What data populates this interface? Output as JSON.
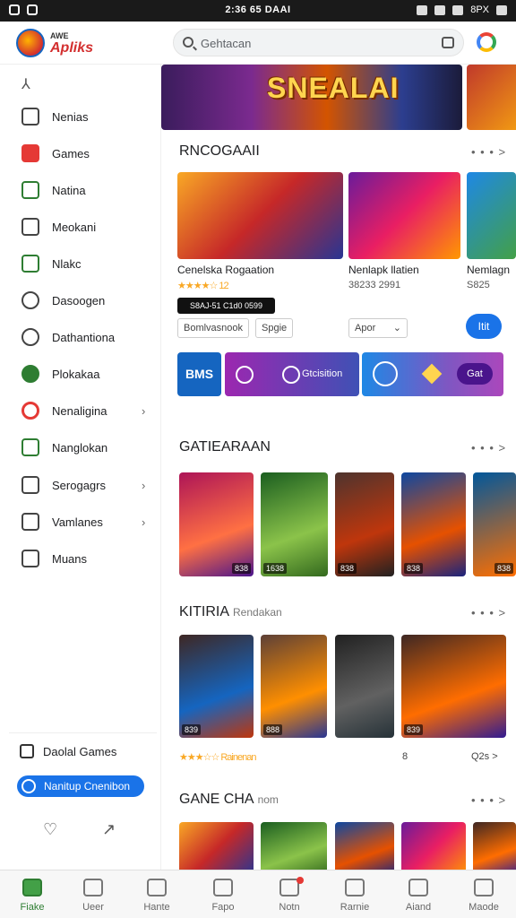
{
  "status_bar": {
    "time": "2:36 65 DAAI",
    "battery": "8PX"
  },
  "header": {
    "logo_line1": "AWE",
    "logo_line2": "Apliks",
    "search_placeholder": "Gehtacan"
  },
  "sidebar": {
    "items": [
      {
        "label": "Nenias",
        "icon": "home-icon",
        "chevron": false
      },
      {
        "label": "Games",
        "icon": "games-icon",
        "chevron": false
      },
      {
        "label": "Natina",
        "icon": "apps-icon",
        "chevron": false
      },
      {
        "label": "Meokani",
        "icon": "chart-icon",
        "chevron": false
      },
      {
        "label": "Nlakc",
        "icon": "leaf-icon",
        "chevron": false
      },
      {
        "label": "Dasoogen",
        "icon": "download-icon",
        "chevron": false
      },
      {
        "label": "Dathantiona",
        "icon": "compass-icon",
        "chevron": false
      },
      {
        "label": "Plokakaa",
        "icon": "globe-icon",
        "chevron": false
      },
      {
        "label": "Nenaligina",
        "icon": "award-icon",
        "chevron": true
      },
      {
        "label": "Nanglokan",
        "icon": "puzzle-icon",
        "chevron": false
      },
      {
        "label": "Serogagrs",
        "icon": "folder-icon",
        "chevron": true
      },
      {
        "label": "Vamlanes",
        "icon": "grid-icon",
        "chevron": true
      },
      {
        "label": "Muans",
        "icon": "list-icon",
        "chevron": false
      }
    ],
    "footer_label": "Daolal Games",
    "pill_label": "Nanitup Cnenibon"
  },
  "hero": {
    "title": "SNEALAI"
  },
  "section1": {
    "title": "RNCOGAAII",
    "more": "• • • >",
    "cards": [
      {
        "title": "Cenelska Rogaation",
        "rating": "★★★★☆ 12",
        "gradient": "g1"
      },
      {
        "title": "Nenlapk llatien",
        "rating": "38233 2991",
        "gradient": "g2"
      },
      {
        "title": "Nemlagn",
        "rating": "S825",
        "gradient": "g3"
      }
    ],
    "price_pill": "S8AJ-51 C1d0 0599",
    "chip1": "Bomlvasnook",
    "chip2": "Spgie",
    "dropdown": "Apor",
    "dropdown_arrow": "⌄",
    "button": "Itit",
    "promo_square": "BMS",
    "promo_mid": "Gtcisition",
    "promo_btn": "Gat"
  },
  "section2": {
    "title": "GATIEARAAN",
    "more": "• • • >",
    "tiles": [
      {
        "badge": "838",
        "gradient": "g4"
      },
      {
        "badge": "1638",
        "gradient": "g5"
      },
      {
        "badge": "838",
        "gradient": "g6"
      },
      {
        "badge": "838",
        "gradient": "g7"
      },
      {
        "badge": "838",
        "gradient": "g8"
      }
    ]
  },
  "section3": {
    "title": "KITIRIA",
    "subtitle": "Rendakan",
    "more": "• • • >",
    "tiles": [
      {
        "badge": "839",
        "gradient": "g9"
      },
      {
        "badge": "888",
        "gradient": "g10"
      },
      {
        "badge": "",
        "gradient": "g11"
      },
      {
        "badge": "839",
        "gradient": "g12"
      },
      {
        "badge": "",
        "gradient": "g13"
      }
    ],
    "rating_row": "★★★☆☆ Rainenan",
    "page_a": "8",
    "page_b": "Q2s >"
  },
  "section4": {
    "title": "GANE CHA",
    "subtitle": "nom",
    "more": "• • • >",
    "tiles": [
      {
        "gradient": "g1"
      },
      {
        "gradient": "g5"
      },
      {
        "gradient": "g7"
      },
      {
        "gradient": "g2"
      },
      {
        "gradient": "g12"
      }
    ]
  },
  "bottom_nav": [
    {
      "label": "Fiake",
      "icon": "home-icon",
      "active": true
    },
    {
      "label": "Ueer",
      "icon": "library-icon",
      "active": false
    },
    {
      "label": "Hante",
      "icon": "gamepad-icon",
      "active": false
    },
    {
      "label": "Fapo",
      "icon": "tag-icon",
      "active": false
    },
    {
      "label": "Notn",
      "icon": "bell-icon",
      "active": false
    },
    {
      "label": "Rarnie",
      "icon": "search-icon",
      "active": false
    },
    {
      "label": "Aiand",
      "icon": "chat-icon",
      "active": false
    },
    {
      "label": "Maode",
      "icon": "profile-icon",
      "active": false
    }
  ],
  "colors": {
    "accent": "#1a73e8",
    "active_nav": "#2e7d32",
    "hero_title": "#ffd54f"
  }
}
